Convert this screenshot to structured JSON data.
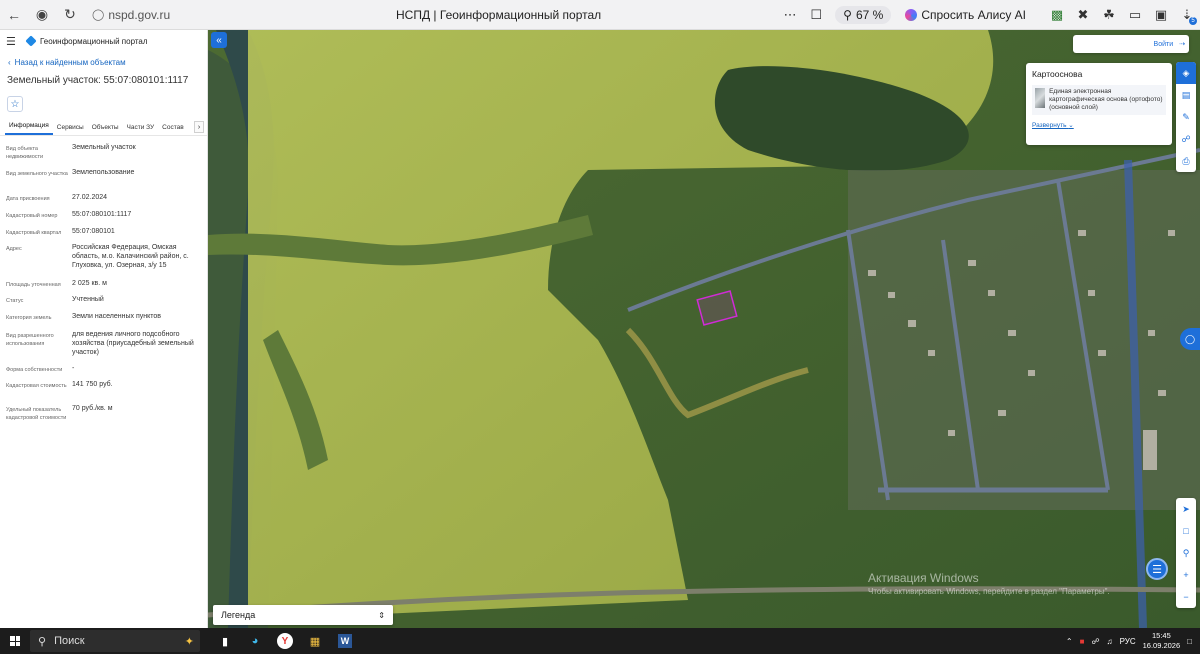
{
  "browser": {
    "url": "nspd.gov.ru",
    "tab_title": "НСПД | Геоинформационный портал",
    "zoom": "67 %",
    "alice": "Спросить Алису AI",
    "download_badge": "5"
  },
  "panel": {
    "portal_name": "Геоинформационный портал",
    "back_link": "Назад к найденным объектам",
    "title": "Земельный участок: 55:07:080101:1117",
    "tabs": [
      "Информация",
      "Сервисы",
      "Объекты",
      "Части ЗУ",
      "Состав"
    ],
    "attributes": [
      {
        "label": "Вид объекта недвижимости",
        "value": "Земельный участок"
      },
      {
        "label": "Вид земельного участка",
        "value": "Землепользование"
      },
      {
        "label": "Дата присвоения",
        "value": "27.02.2024"
      },
      {
        "label": "Кадастровый номер",
        "value": "55:07:080101:1117"
      },
      {
        "label": "Кадастровый квартал",
        "value": "55:07:080101"
      },
      {
        "label": "Адрес",
        "value": "Российская Федерация, Омская область, м.о. Калачинский район, с. Глуховка, ул. Озерная, з/у 15"
      },
      {
        "label": "Площадь уточненная",
        "value": "2 025 кв. м"
      },
      {
        "label": "Статус",
        "value": "Учтенный"
      },
      {
        "label": "Категория земель",
        "value": "Земли населенных пунктов"
      },
      {
        "label": "Вид разрешенного использования",
        "value": "для ведения личного подсобного хозяйства (приусадебный земельный участок)"
      },
      {
        "label": "Форма собственности",
        "value": "-"
      },
      {
        "label": "Кадастровая стоимость",
        "value": "141 750 руб."
      },
      {
        "label": "Удельный показатель кадастровой стоимости",
        "value": "70 руб./кв. м"
      }
    ]
  },
  "map": {
    "login": "Войти",
    "basemap": {
      "title": "Картооснова",
      "item": "Единая электронная картографическая основа (ортофото)(основной слой)",
      "expand": "Развернуть"
    },
    "legend": "Легенда",
    "watermark_title": "Активация Windows",
    "watermark_sub": "Чтобы активировать Windows, перейдите в раздел \"Параметры\"."
  },
  "taskbar": {
    "search": "Поиск",
    "lang": "РУС",
    "time": "15:45",
    "date": "16.09.2026"
  },
  "colors": {
    "accent": "#1e6fd9",
    "parcel_outline": "#d02bd6",
    "field_overlay": "#c6cf5e"
  }
}
